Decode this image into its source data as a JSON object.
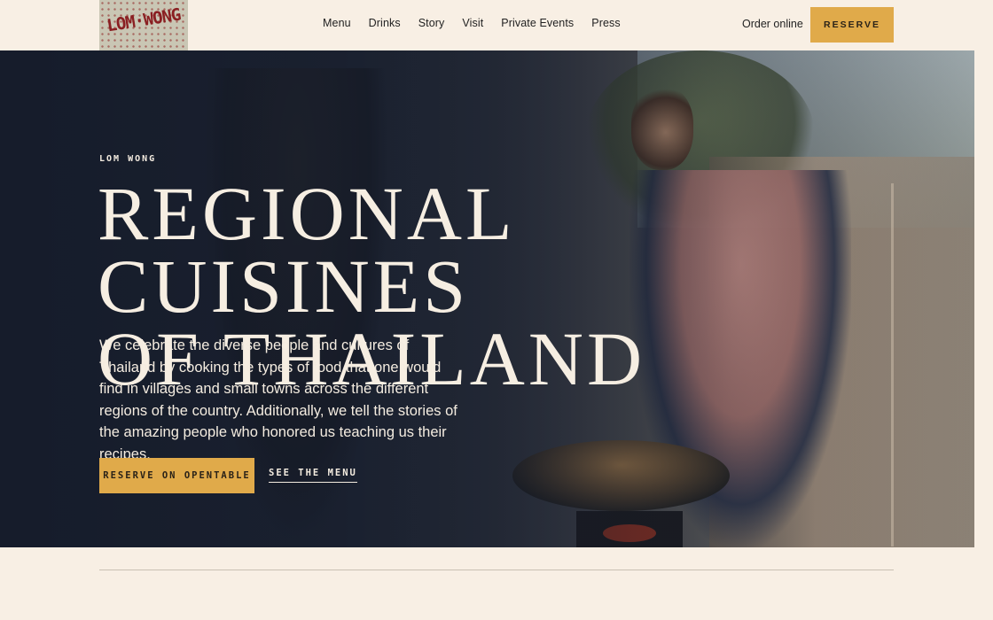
{
  "brand": {
    "logo_text": "LOM·WONG"
  },
  "nav": {
    "items": [
      {
        "label": "Menu"
      },
      {
        "label": "Drinks"
      },
      {
        "label": "Story"
      },
      {
        "label": "Visit"
      },
      {
        "label": "Private Events"
      },
      {
        "label": "Press"
      }
    ],
    "order_online": "Order online",
    "reserve": "RESERVE"
  },
  "hero": {
    "eyebrow": "LOM WONG",
    "headline_line1": "REGIONAL CUISINES",
    "headline_line2": "OF THAILAND",
    "intro": "We celebrate the diverse people and cultures of Thailand by cooking the types of food that one would find in villages and small towns across the different regions of the country. Additionally, we tell the stories of the amazing people who honored us teaching us their recipes.",
    "cta_primary": "RESERVE ON OPENTABLE",
    "cta_secondary": "SEE THE MENU"
  },
  "colors": {
    "background": "#f8efe4",
    "accent": "#e0aa4a",
    "hero_text": "#f6eee2"
  }
}
